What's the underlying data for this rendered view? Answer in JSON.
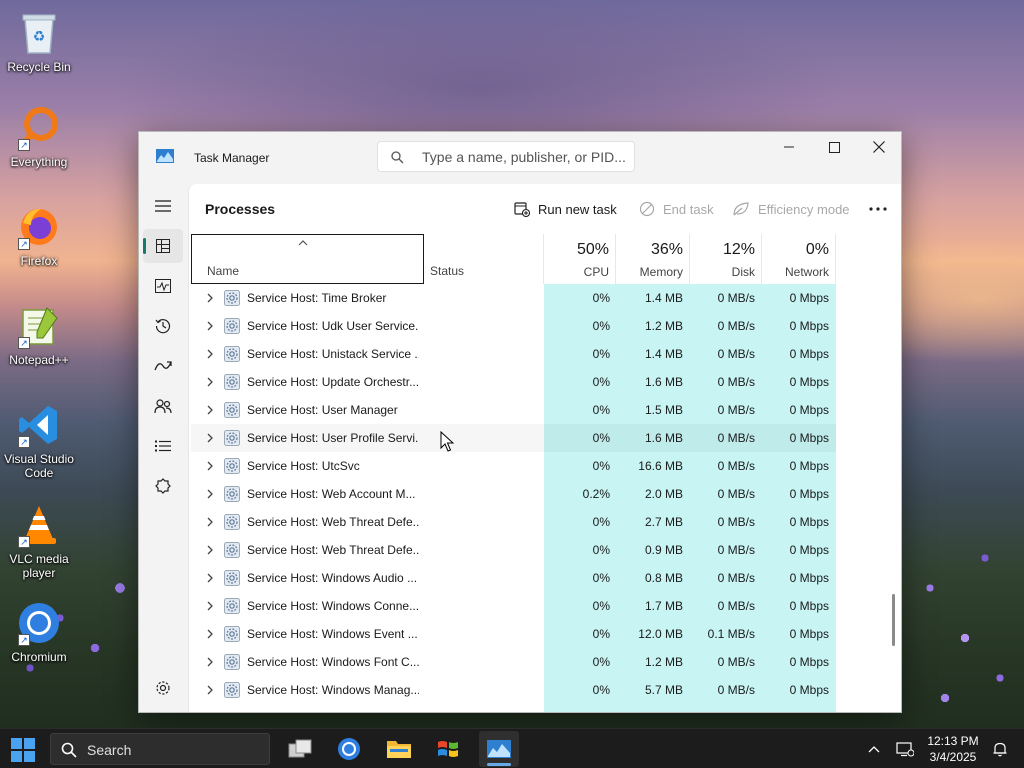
{
  "desktop": {
    "icons": [
      {
        "label": "Recycle Bin",
        "icon": "recycle-bin-icon"
      },
      {
        "label": "Everything",
        "icon": "everything-search-icon"
      },
      {
        "label": "Firefox",
        "icon": "firefox-icon"
      },
      {
        "label": "Notepad++",
        "icon": "notepad-plus-plus-icon"
      },
      {
        "label": "Visual Studio Code",
        "icon": "vscode-icon"
      },
      {
        "label": "VLC media player",
        "icon": "vlc-icon"
      },
      {
        "label": "Chromium",
        "icon": "chromium-icon"
      }
    ]
  },
  "window": {
    "title": "Task Manager",
    "search_placeholder": "Type a name, publisher, or PID...",
    "controls": [
      "minimize",
      "maximize",
      "close"
    ]
  },
  "nav": {
    "items": [
      {
        "name": "menu",
        "icon": "hamburger-icon"
      },
      {
        "name": "processes",
        "icon": "processes-icon",
        "active": true
      },
      {
        "name": "performance",
        "icon": "performance-icon"
      },
      {
        "name": "app-history",
        "icon": "history-icon"
      },
      {
        "name": "startup-apps",
        "icon": "startup-icon"
      },
      {
        "name": "users",
        "icon": "users-icon"
      },
      {
        "name": "details",
        "icon": "details-list-icon"
      },
      {
        "name": "services",
        "icon": "services-icon"
      },
      {
        "name": "settings",
        "icon": "settings-gear-icon"
      }
    ]
  },
  "processes": {
    "title": "Processes",
    "toolbar": {
      "run_new_task": "Run new task",
      "end_task": "End task",
      "efficiency_mode": "Efficiency mode"
    },
    "columns": {
      "name": "Name",
      "status": "Status",
      "cpu": {
        "label": "CPU",
        "pct": "50%"
      },
      "memory": {
        "label": "Memory",
        "pct": "36%"
      },
      "disk": {
        "label": "Disk",
        "pct": "12%"
      },
      "network": {
        "label": "Network",
        "pct": "0%"
      }
    },
    "rows": [
      {
        "name": "Service Host: Time Broker",
        "cpu": "0%",
        "memory": "1.4 MB",
        "disk": "0 MB/s",
        "network": "0 Mbps"
      },
      {
        "name": "Service Host: Udk User Service...",
        "cpu": "0%",
        "memory": "1.2 MB",
        "disk": "0 MB/s",
        "network": "0 Mbps"
      },
      {
        "name": "Service Host: Unistack Service ...",
        "cpu": "0%",
        "memory": "1.4 MB",
        "disk": "0 MB/s",
        "network": "0 Mbps"
      },
      {
        "name": "Service Host: Update Orchestr...",
        "cpu": "0%",
        "memory": "1.6 MB",
        "disk": "0 MB/s",
        "network": "0 Mbps"
      },
      {
        "name": "Service Host: User Manager",
        "cpu": "0%",
        "memory": "1.5 MB",
        "disk": "0 MB/s",
        "network": "0 Mbps"
      },
      {
        "name": "Service Host: User Profile Servi...",
        "cpu": "0%",
        "memory": "1.6 MB",
        "disk": "0 MB/s",
        "network": "0 Mbps"
      },
      {
        "name": "Service Host: UtcSvc",
        "cpu": "0%",
        "memory": "16.6 MB",
        "disk": "0 MB/s",
        "network": "0 Mbps"
      },
      {
        "name": "Service Host: Web Account M...",
        "cpu": "0.2%",
        "memory": "2.0 MB",
        "disk": "0 MB/s",
        "network": "0 Mbps"
      },
      {
        "name": "Service Host: Web Threat Defe...",
        "cpu": "0%",
        "memory": "2.7 MB",
        "disk": "0 MB/s",
        "network": "0 Mbps"
      },
      {
        "name": "Service Host: Web Threat Defe...",
        "cpu": "0%",
        "memory": "0.9 MB",
        "disk": "0 MB/s",
        "network": "0 Mbps"
      },
      {
        "name": "Service Host: Windows Audio ...",
        "cpu": "0%",
        "memory": "0.8 MB",
        "disk": "0 MB/s",
        "network": "0 Mbps"
      },
      {
        "name": "Service Host: Windows Conne...",
        "cpu": "0%",
        "memory": "1.7 MB",
        "disk": "0 MB/s",
        "network": "0 Mbps"
      },
      {
        "name": "Service Host: Windows Event ...",
        "cpu": "0%",
        "memory": "12.0 MB",
        "disk": "0.1 MB/s",
        "network": "0 Mbps"
      },
      {
        "name": "Service Host: Windows Font C...",
        "cpu": "0%",
        "memory": "1.2 MB",
        "disk": "0 MB/s",
        "network": "0 Mbps"
      },
      {
        "name": "Service Host: Windows Manag...",
        "cpu": "0%",
        "memory": "5.7 MB",
        "disk": "0 MB/s",
        "network": "0 Mbps"
      }
    ]
  },
  "taskbar": {
    "search_label": "Search",
    "apps": [
      "task-view-icon",
      "chromium-icon",
      "file-explorer-icon",
      "windows-logo-icon",
      "task-manager-icon"
    ],
    "time": "12:13 PM",
    "date": "3/4/2025"
  },
  "colors": {
    "accent": "#157a6a",
    "metric_highlight": "#c8f4f4",
    "taskbar": "#1c1c1c"
  }
}
